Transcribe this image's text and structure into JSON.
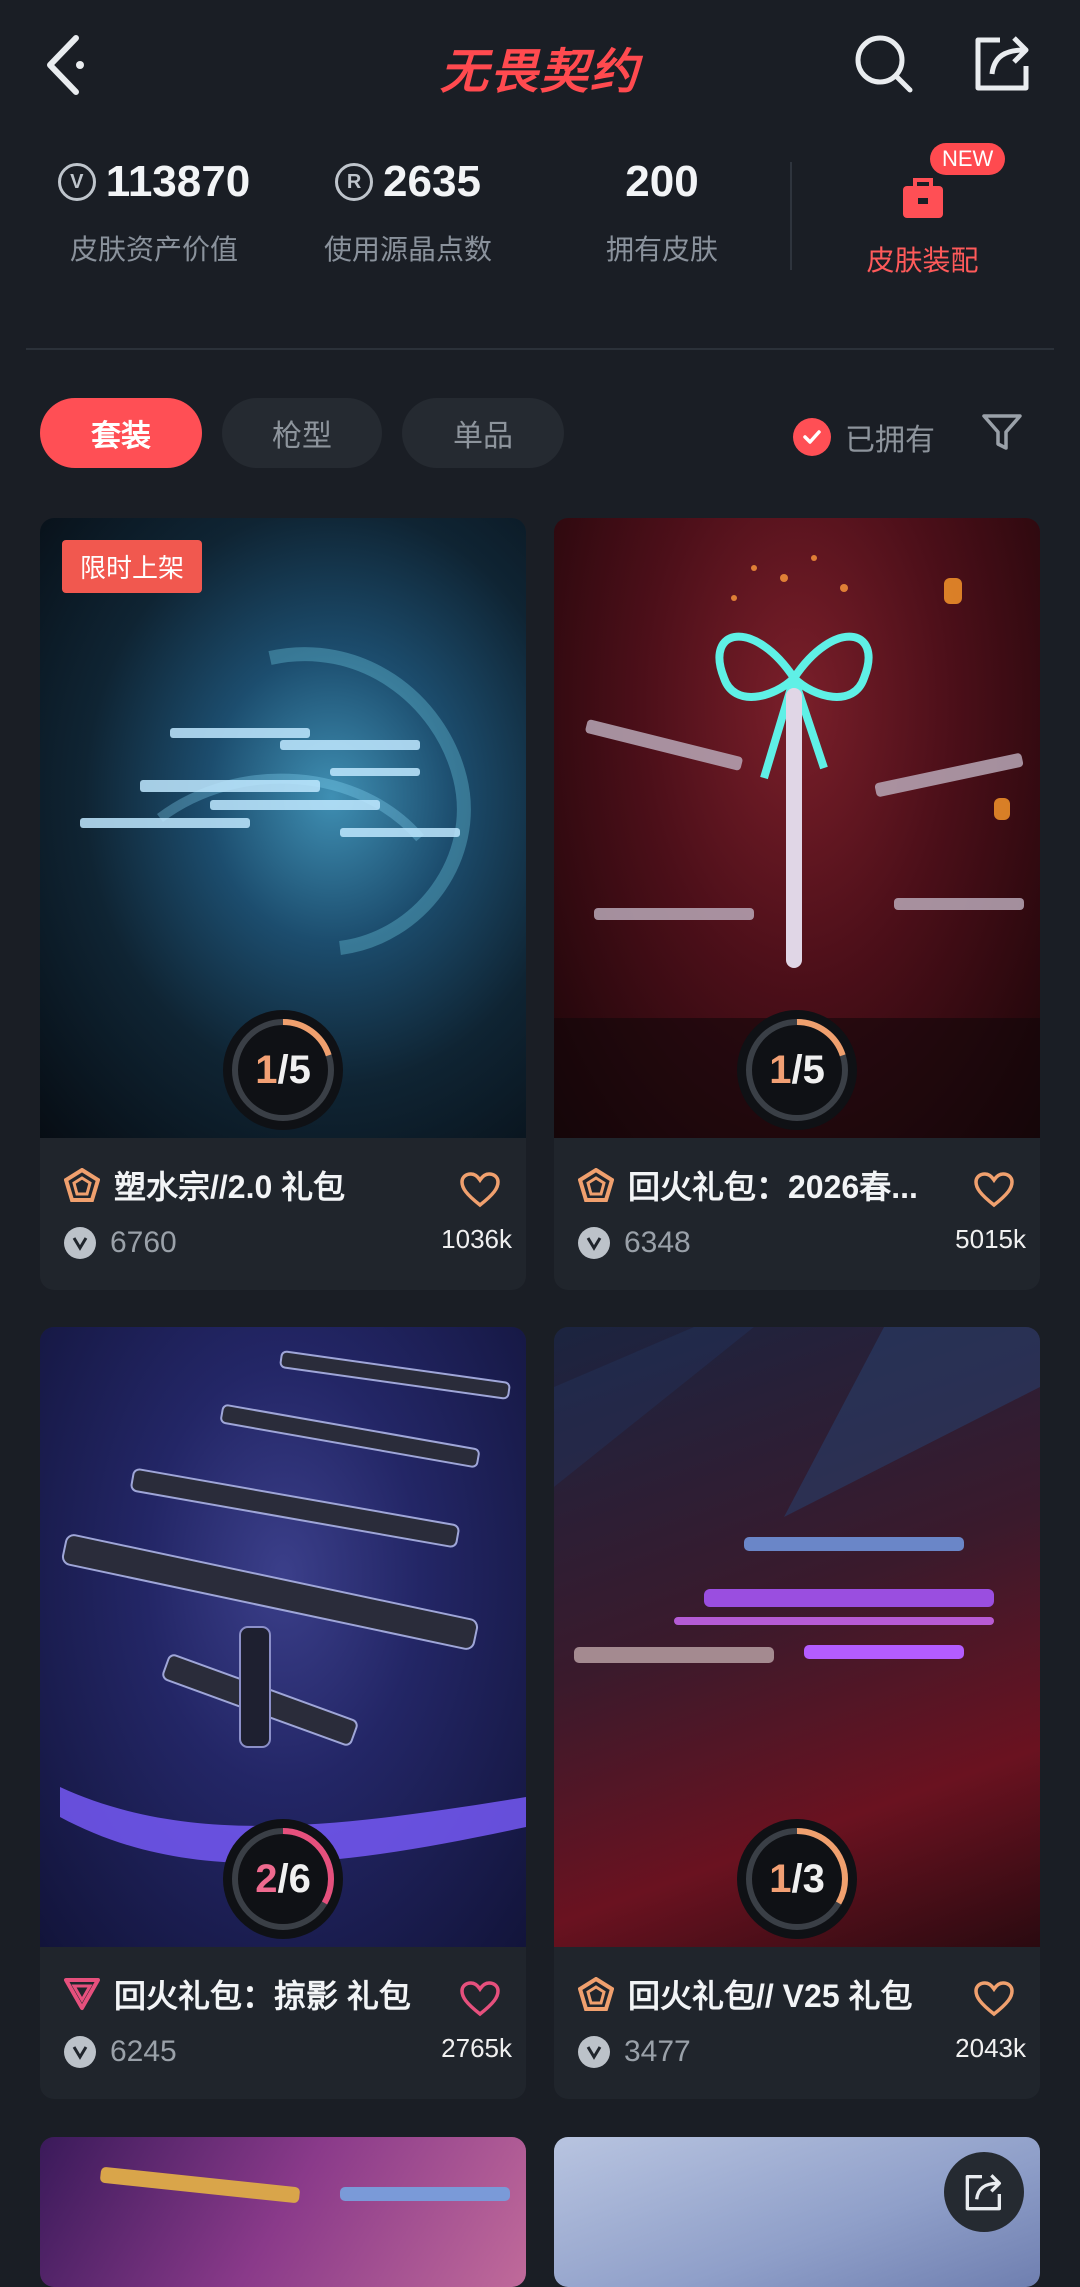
{
  "header": {
    "title": "无畏契约"
  },
  "stats": [
    {
      "value": "113870",
      "label": "皮肤资产价值",
      "icon": "valorant-points-icon"
    },
    {
      "value": "2635",
      "label": "使用源晶点数",
      "icon": "radianite-icon"
    },
    {
      "value": "200",
      "label": "拥有皮肤",
      "icon": ""
    }
  ],
  "equip": {
    "label": "皮肤装配",
    "badge": "NEW"
  },
  "tabs": [
    {
      "label": "套装",
      "active": true
    },
    {
      "label": "枪型",
      "active": false
    },
    {
      "label": "单品",
      "active": false
    }
  ],
  "filter": {
    "owned_label": "已拥有",
    "owned_checked": true
  },
  "cards": [
    {
      "tag": "限时上架",
      "name": "塑水宗//2.0 礼包",
      "price": "6760",
      "likes": "1036k",
      "owned": "1",
      "total": "5",
      "progress": 0.2,
      "tier_color": "#f0a06e",
      "liked": true
    },
    {
      "tag": "",
      "name": "回火礼包：2026春...",
      "price": "6348",
      "likes": "5015k",
      "owned": "1",
      "total": "5",
      "progress": 0.2,
      "tier_color": "#f0a06e",
      "liked": true
    },
    {
      "tag": "",
      "name": "回火礼包：掠影 礼包",
      "price": "6245",
      "likes": "2765k",
      "owned": "2",
      "total": "6",
      "progress": 0.333,
      "tier_color": "#e6507d",
      "liked": true
    },
    {
      "tag": "",
      "name": "回火礼包// V25 礼包",
      "price": "3477",
      "likes": "2043k",
      "owned": "1",
      "total": "3",
      "progress": 0.333,
      "tier_color": "#f0a06e",
      "liked": true
    }
  ],
  "colors": {
    "accent": "#ff4f55",
    "background": "#1a1e25"
  }
}
